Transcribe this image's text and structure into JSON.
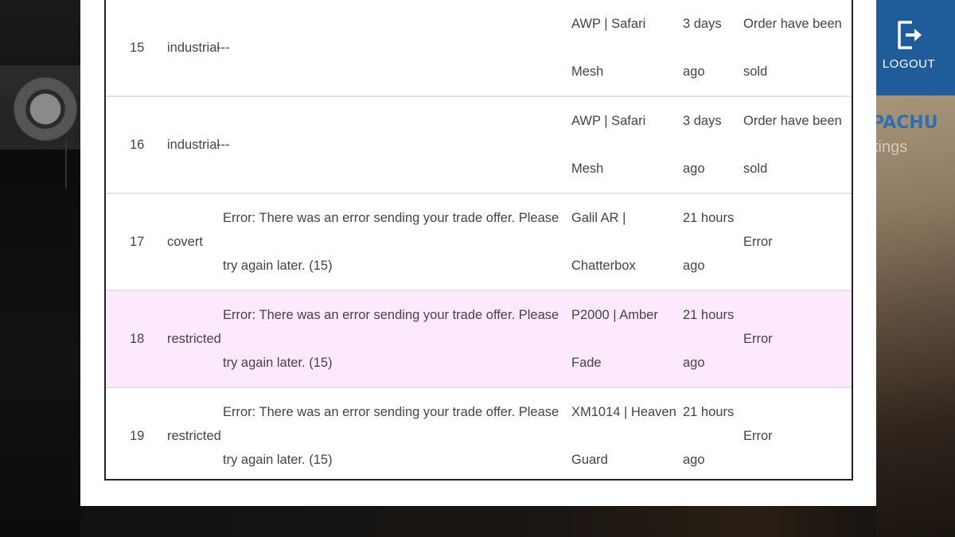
{
  "background": {
    "logout_label": "LOGOUT",
    "title_fragment": "PACHU",
    "subtitle_fragment": "tings",
    "header_color": "#1f5c99"
  },
  "orders": [
    {
      "id": "15",
      "rarity": "industrial",
      "message": "---",
      "item": "AWP | Safari Mesh",
      "time": "3 days ago",
      "status": "Order have been sold",
      "highlight": false
    },
    {
      "id": "16",
      "rarity": "industrial",
      "message": "---",
      "item": "AWP | Safari Mesh",
      "time": "3 days ago",
      "status": "Order have been sold",
      "highlight": false
    },
    {
      "id": "17",
      "rarity": "covert",
      "message": "Error: There was an error sending your trade offer. Please try again later. (15)",
      "item": "Galil AR | Chatterbox",
      "time": "21 hours ago",
      "status": "Error",
      "highlight": false
    },
    {
      "id": "18",
      "rarity": "restricted",
      "message": "Error: There was an error sending your trade offer. Please try again later. (15)",
      "item": "P2000 | Amber Fade",
      "time": "21 hours ago",
      "status": "Error",
      "highlight": true
    },
    {
      "id": "19",
      "rarity": "restricted",
      "message": "Error: There was an error sending your trade offer. Please try again later. (15)",
      "item": "XM1014 | Heaven Guard",
      "time": "21 hours ago",
      "status": "Error",
      "highlight": false
    }
  ],
  "colors": {
    "highlight_row": "#fde9fd",
    "text": "#444444"
  }
}
